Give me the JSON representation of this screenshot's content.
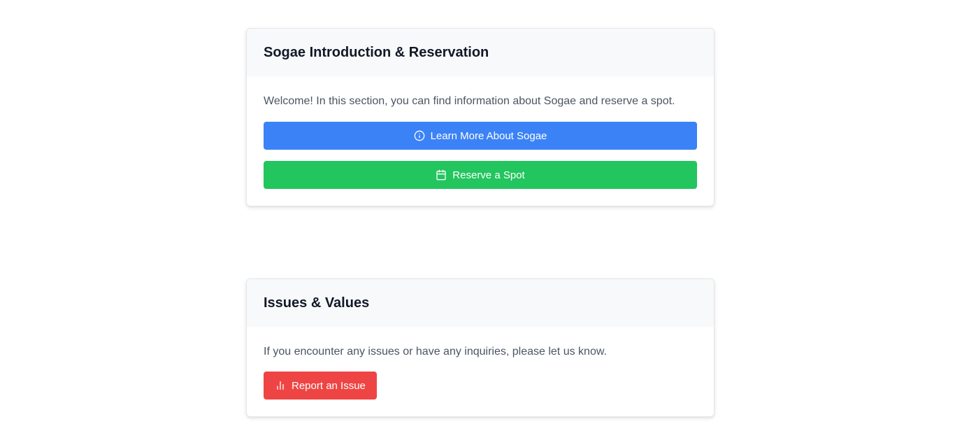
{
  "intro_card": {
    "title": "Sogae Introduction & Reservation",
    "description": "Welcome! In this section, you can find information about Sogae and reserve a spot.",
    "learn_more_label": "Learn More About Sogae",
    "learn_more_icon": "info-icon",
    "reserve_label": "Reserve a Spot",
    "reserve_icon": "calendar-icon"
  },
  "issues_card": {
    "title": "Issues & Values",
    "description": "If you encounter any issues or have any inquiries, please let us know.",
    "report_label": "Report an Issue",
    "report_icon": "bar-chart-icon"
  },
  "colors": {
    "primary_blue": "#3b82f6",
    "success_green": "#22c55e",
    "danger_red": "#ef4444",
    "header_bg": "#f8f9fa",
    "title_text": "#111827",
    "body_text": "#4b5563"
  }
}
